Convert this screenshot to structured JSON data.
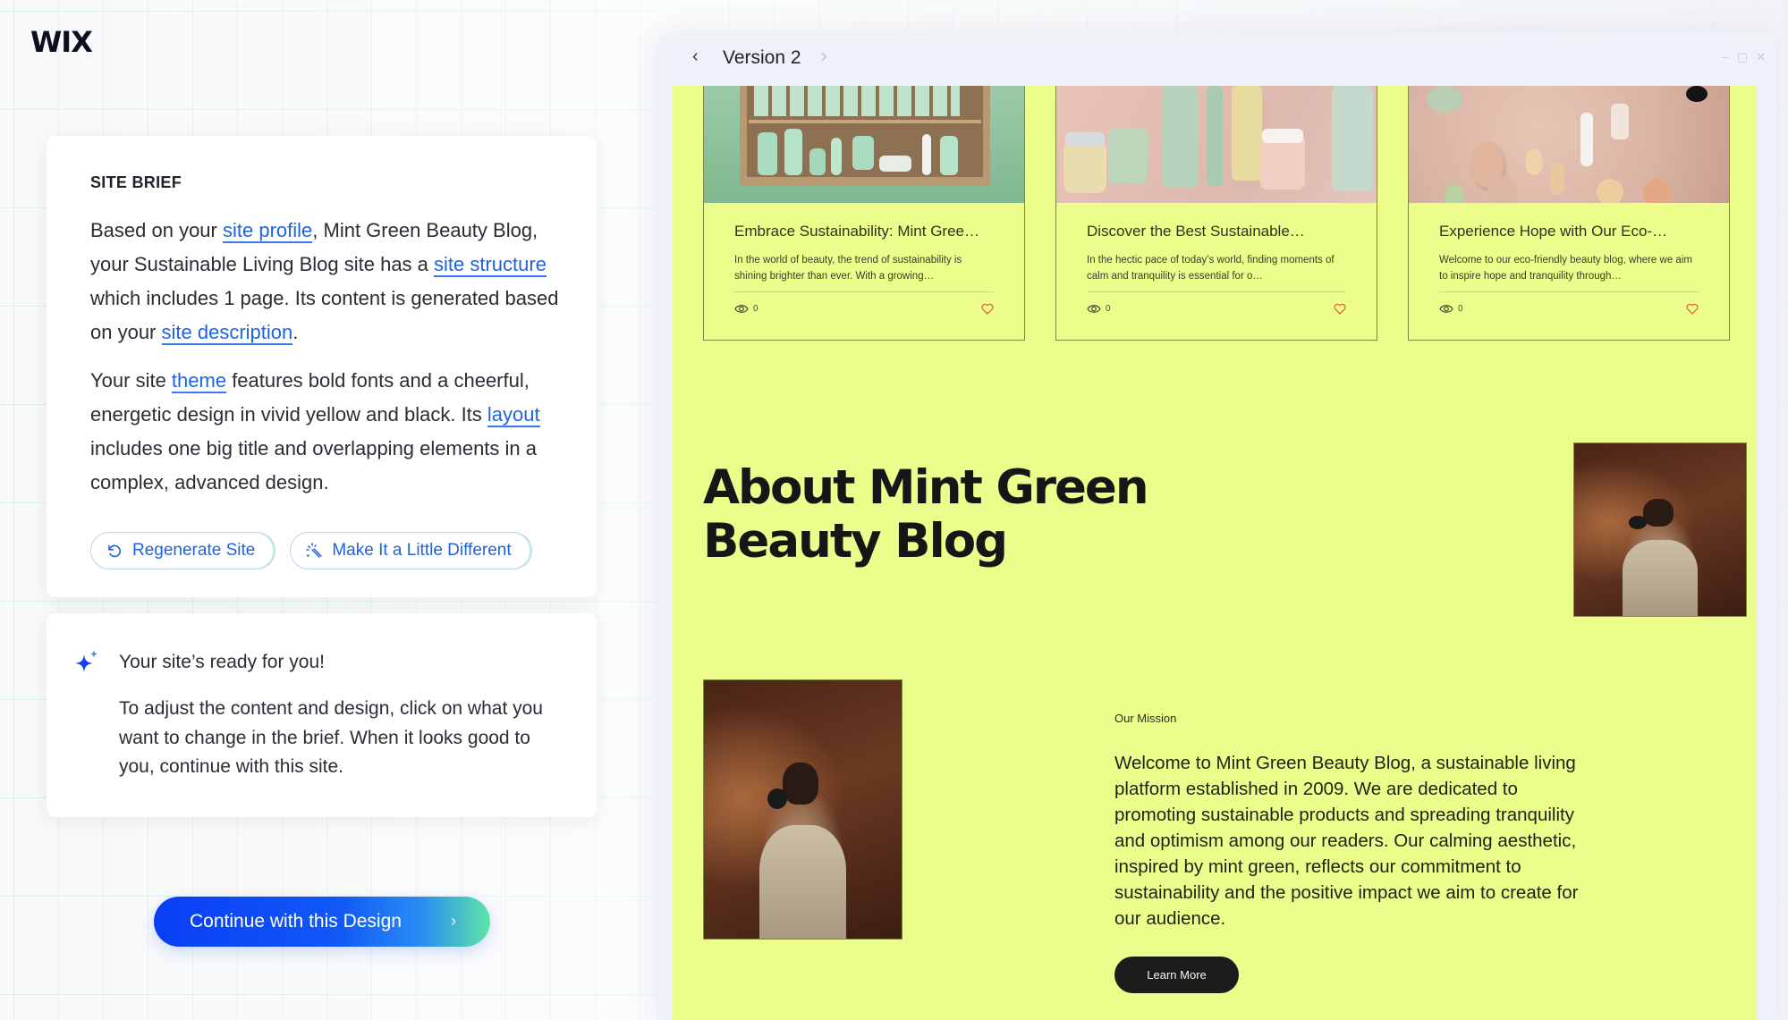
{
  "brand": {
    "logo": "WIX"
  },
  "site_brief": {
    "title": "SITE BRIEF",
    "para1": {
      "t1": "Based on your ",
      "link_profile": "site profile",
      "t2": ", Mint Green Beauty Blog, your Sustainable Living Blog site has a ",
      "link_structure": "site structure",
      "t3": " which includes 1 page. Its content is generated based on your ",
      "link_description": "site description",
      "t4": "."
    },
    "para2": {
      "t1": "Your site ",
      "link_theme": "theme",
      "t2": " features bold fonts and a cheerful, energetic design in vivid yellow and black. Its ",
      "link_layout": "layout",
      "t3": " includes one big title and overlapping elements in a complex, advanced design."
    },
    "actions": {
      "regenerate": {
        "label": "Regenerate Site",
        "icon": "refresh-icon"
      },
      "different": {
        "label": "Make It a Little Different",
        "icon": "magic-wand-icon"
      }
    }
  },
  "ready": {
    "icon": "sparkle-icon",
    "title": "Your site’s ready for you!",
    "body": "To adjust the content and design, click on what you want to change in the brief. When it looks good to you, continue with this site."
  },
  "continue_button": {
    "label": "Continue with this Design",
    "chevron": "›"
  },
  "preview": {
    "prev_icon": "‹",
    "version_label": "Version 2",
    "next_icon": "›",
    "window_controls": {
      "minimize": "–",
      "maximize": "▢",
      "close": "✕"
    },
    "colors": {
      "site_background": "#ecfd8b",
      "accent_link": "#1f63e0",
      "heart": "#e0673a"
    },
    "blog_posts": [
      {
        "title": "Embrace Sustainability: Mint Gree…",
        "excerpt": "In the world of beauty, the trend of sustainability is shining brighter than ever. With a growing…",
        "views": "0",
        "image": "mint-green-product-shelf"
      },
      {
        "title": "Discover the Best Sustainable…",
        "excerpt": "In the hectic pace of today’s world, finding moments of calm and tranquility is essential for o…",
        "views": "0",
        "image": "skincare-jars-pink-backdrop"
      },
      {
        "title": "Experience Hope with Our Eco-…",
        "excerpt": "Welcome to our eco-friendly beauty blog, where we aim to inspire hope and tranquility through…",
        "views": "0",
        "image": "makeup-palette-flatlay"
      }
    ],
    "about": {
      "title_line1": "About Mint Green",
      "title_line2": "Beauty Blog",
      "mission_label": "Our Mission",
      "mission_text": "Welcome to Mint Green Beauty Blog, a sustainable living platform established in 2009. We are dedicated to promoting sustainable products and spreading tranquility and optimism among our readers. Our calming aesthetic, inspired by mint green, reflects our commitment to sustainability and the positive impact we aim to create for our audience.",
      "learn_more": "Learn More",
      "photo_alt": "person-in-gas-mask-smoke"
    }
  }
}
